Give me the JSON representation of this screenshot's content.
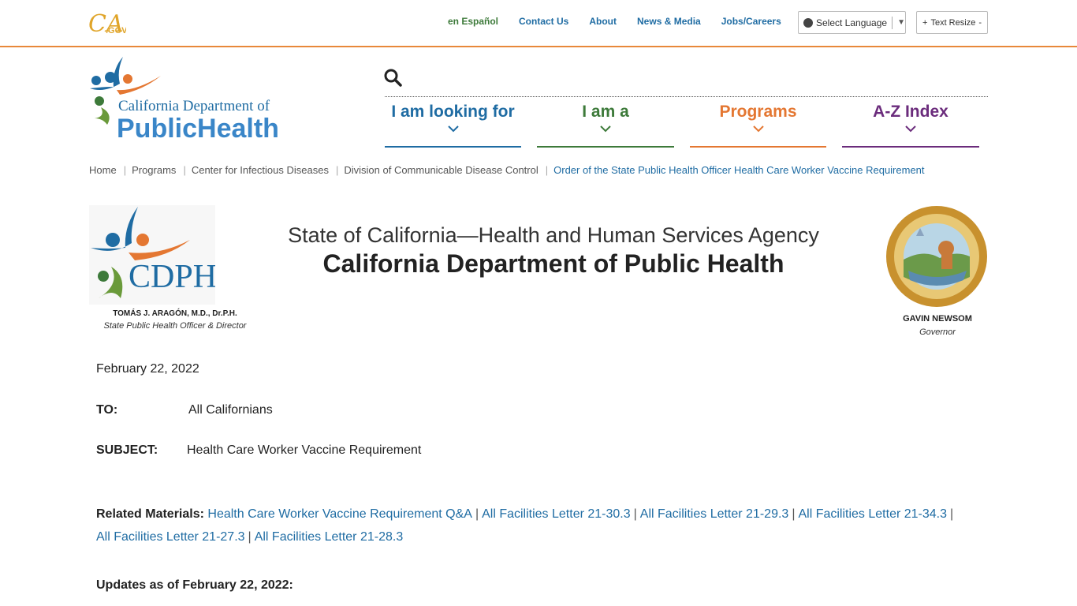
{
  "utility": {
    "links": [
      {
        "label": "en Español"
      },
      {
        "label": "Contact Us"
      },
      {
        "label": "About"
      },
      {
        "label": "News & Media"
      },
      {
        "label": "Jobs/Careers"
      }
    ],
    "language_label": "Select Language",
    "text_resize": {
      "plus": "+",
      "label": "Text Resize",
      "minus": "-"
    }
  },
  "nav": {
    "items": [
      {
        "label": "I am looking for"
      },
      {
        "label": "I am a"
      },
      {
        "label": "Programs"
      },
      {
        "label": "A-Z Index"
      }
    ]
  },
  "logo": {
    "line1": "California Department of",
    "line2": "PublicHealth"
  },
  "breadcrumb": [
    "Home",
    "Programs",
    "Center for Infectious Diseases",
    "Division of Communicable Disease Control",
    "Order of the State Public Health Officer Health Care Worker Vaccine Requirement"
  ],
  "letterhead": {
    "agency_line": "State of California—Health and Human Services Agency",
    "department_line": "California Department of Public Health",
    "officer_name": "TOMÁS J. ARAGÓN, M.D., Dr.P.H.",
    "officer_title": "State Public Health Officer & Director",
    "governor_name": "GAVIN NEWSOM",
    "governor_title": "Governor",
    "cdph_text": "CDPH"
  },
  "memo": {
    "date": "February 22, 2022",
    "to_label": "TO:",
    "to_value": "All Californians",
    "subject_label": "SUBJECT:",
    "subject_value": "Health Care Worker Vaccine Requirement",
    "related_label": "Related Materials:",
    "related_links": [
      "Health Care Worker Vaccine Requirement Q&A",
      "All Facilities Letter 21-30.3",
      "All Facilities Letter 21-29.3",
      "All Facilities Letter 21-34.3",
      "All Facilities Letter 21-27.3",
      "All Facilities Letter 21-28.3"
    ],
    "updates_heading": "Updates as of February 22, 2022:"
  },
  "colors": {
    "blue": "#1f6ca3",
    "green": "#3d7a3a",
    "orange": "#e47732",
    "purple": "#6b2c7c",
    "accent_line": "#e8883a"
  }
}
